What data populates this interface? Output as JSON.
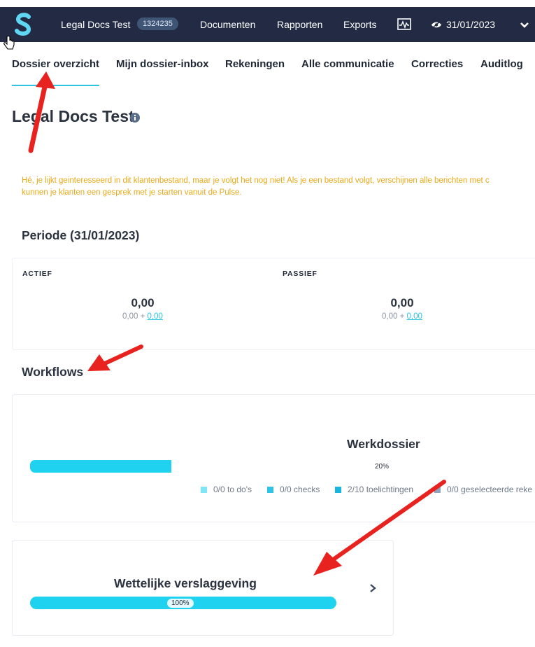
{
  "topbar": {
    "logo_letter": "S",
    "client_name": "Legal Docs Test",
    "client_id": "1324235",
    "nav": [
      "Documenten",
      "Rapporten",
      "Exports"
    ],
    "date": "31/01/2023"
  },
  "tabs": [
    "Dossier overzicht",
    "Mijn dossier-inbox",
    "Rekeningen",
    "Alle communicatie",
    "Correcties",
    "Auditlog"
  ],
  "active_tab": "Dossier overzicht",
  "page_title": "Legal Docs Test",
  "notice": {
    "line1": "Hé, je lijkt geinteresseerd in dit klantenbestand, maar je volgt het nog niet! Als je een bestand volgt, verschijnen alle berichten met c",
    "line2": "kunnen je klanten een gesprek met je starten vanuit de Pulse."
  },
  "period": {
    "title": "Periode (31/01/2023)",
    "actief": {
      "label": "ACTIEF",
      "value": "0,00",
      "sub_prefix": "0,00 + ",
      "sub_link": "0,00"
    },
    "passief": {
      "label": "PASSIEF",
      "value": "0,00",
      "sub_prefix": "0,00 + ",
      "sub_link": "0,00"
    }
  },
  "workflows": {
    "title": "Workflows",
    "items": [
      {
        "name": "Werkdossier",
        "progress_pct": 20,
        "progress_label": "20%",
        "legend": [
          {
            "label": "0/0 to do's",
            "color": "#7fe6f5"
          },
          {
            "label": "0/0 checks",
            "color": "#2ec4e3"
          },
          {
            "label": "2/10 toelichtingen",
            "color": "#17b6dc"
          },
          {
            "label": "0/0 geselecteerde reke",
            "color": "#8fa3bd"
          }
        ]
      },
      {
        "name": "Wettelijke verslaggeving",
        "progress_pct": 100,
        "progress_label": "100%"
      }
    ]
  },
  "colors": {
    "navbar": "#222a44",
    "accent": "#2ec4e3",
    "progress": "#1fd3f0",
    "notice": "#e8a918",
    "annotation_arrow": "#e8231f"
  }
}
